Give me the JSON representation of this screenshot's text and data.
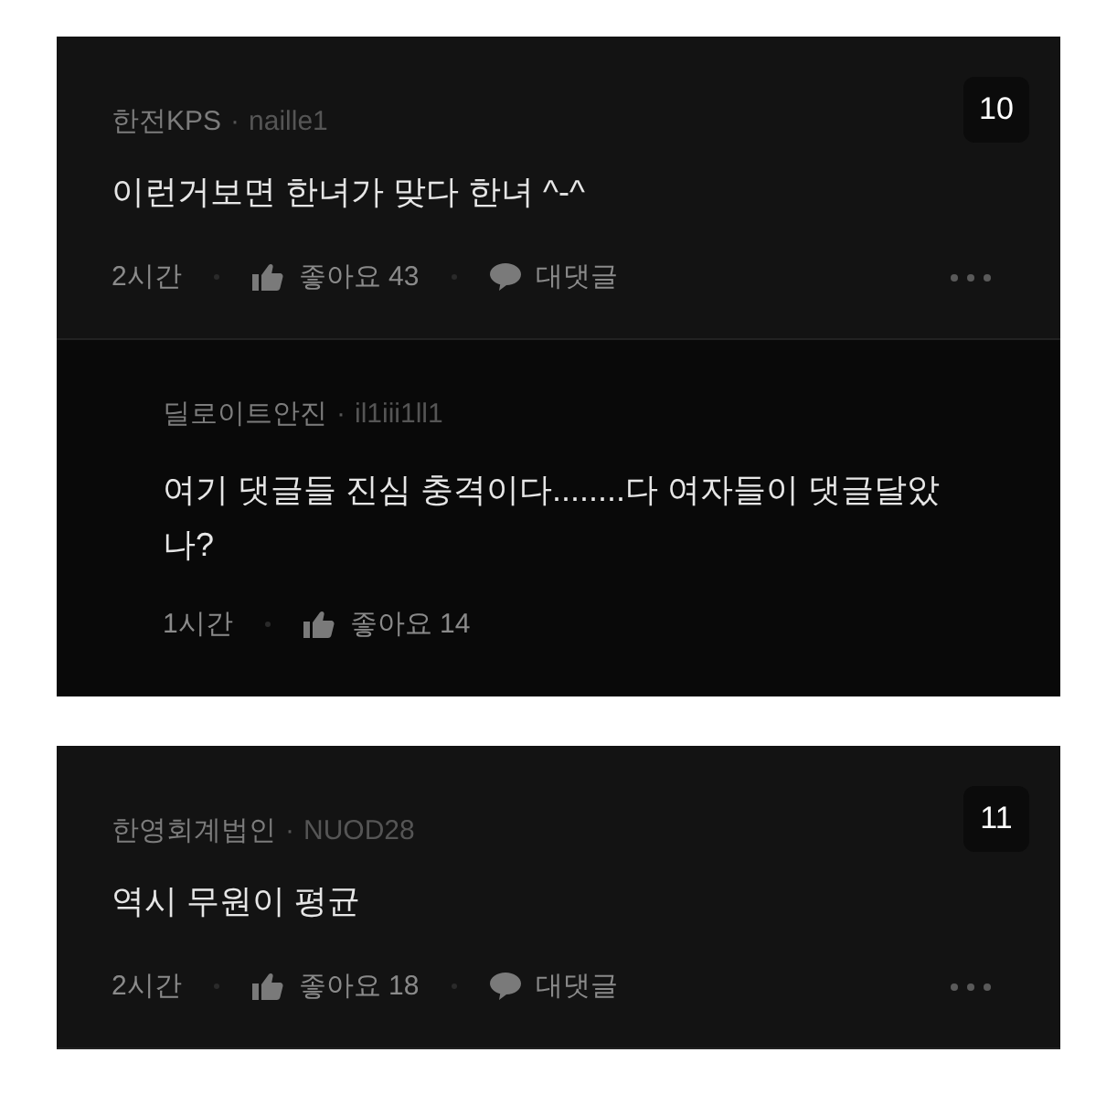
{
  "comments": [
    {
      "rank": "10",
      "author": "한전KPS",
      "separator": "·",
      "user_id": "naille1",
      "body": "이런거보면 한녀가 맞다 한녀 ^-^",
      "time": "2시간",
      "likes": "좋아요 43",
      "reply_label": "대댓글",
      "replies": [
        {
          "author": "딜로이트안진",
          "separator": "·",
          "user_id": "il1iii1ll1",
          "body": "여기 댓글들 진심 충격이다........다 여자들이 댓글달았나?",
          "time": "1시간",
          "likes": "좋아요 14"
        }
      ]
    },
    {
      "rank": "11",
      "author": "한영회계법인",
      "separator": "·",
      "user_id": "NUOD28",
      "body": "역시 무원이 평균",
      "time": "2시간",
      "likes": "좋아요 18",
      "reply_label": "대댓글"
    }
  ]
}
